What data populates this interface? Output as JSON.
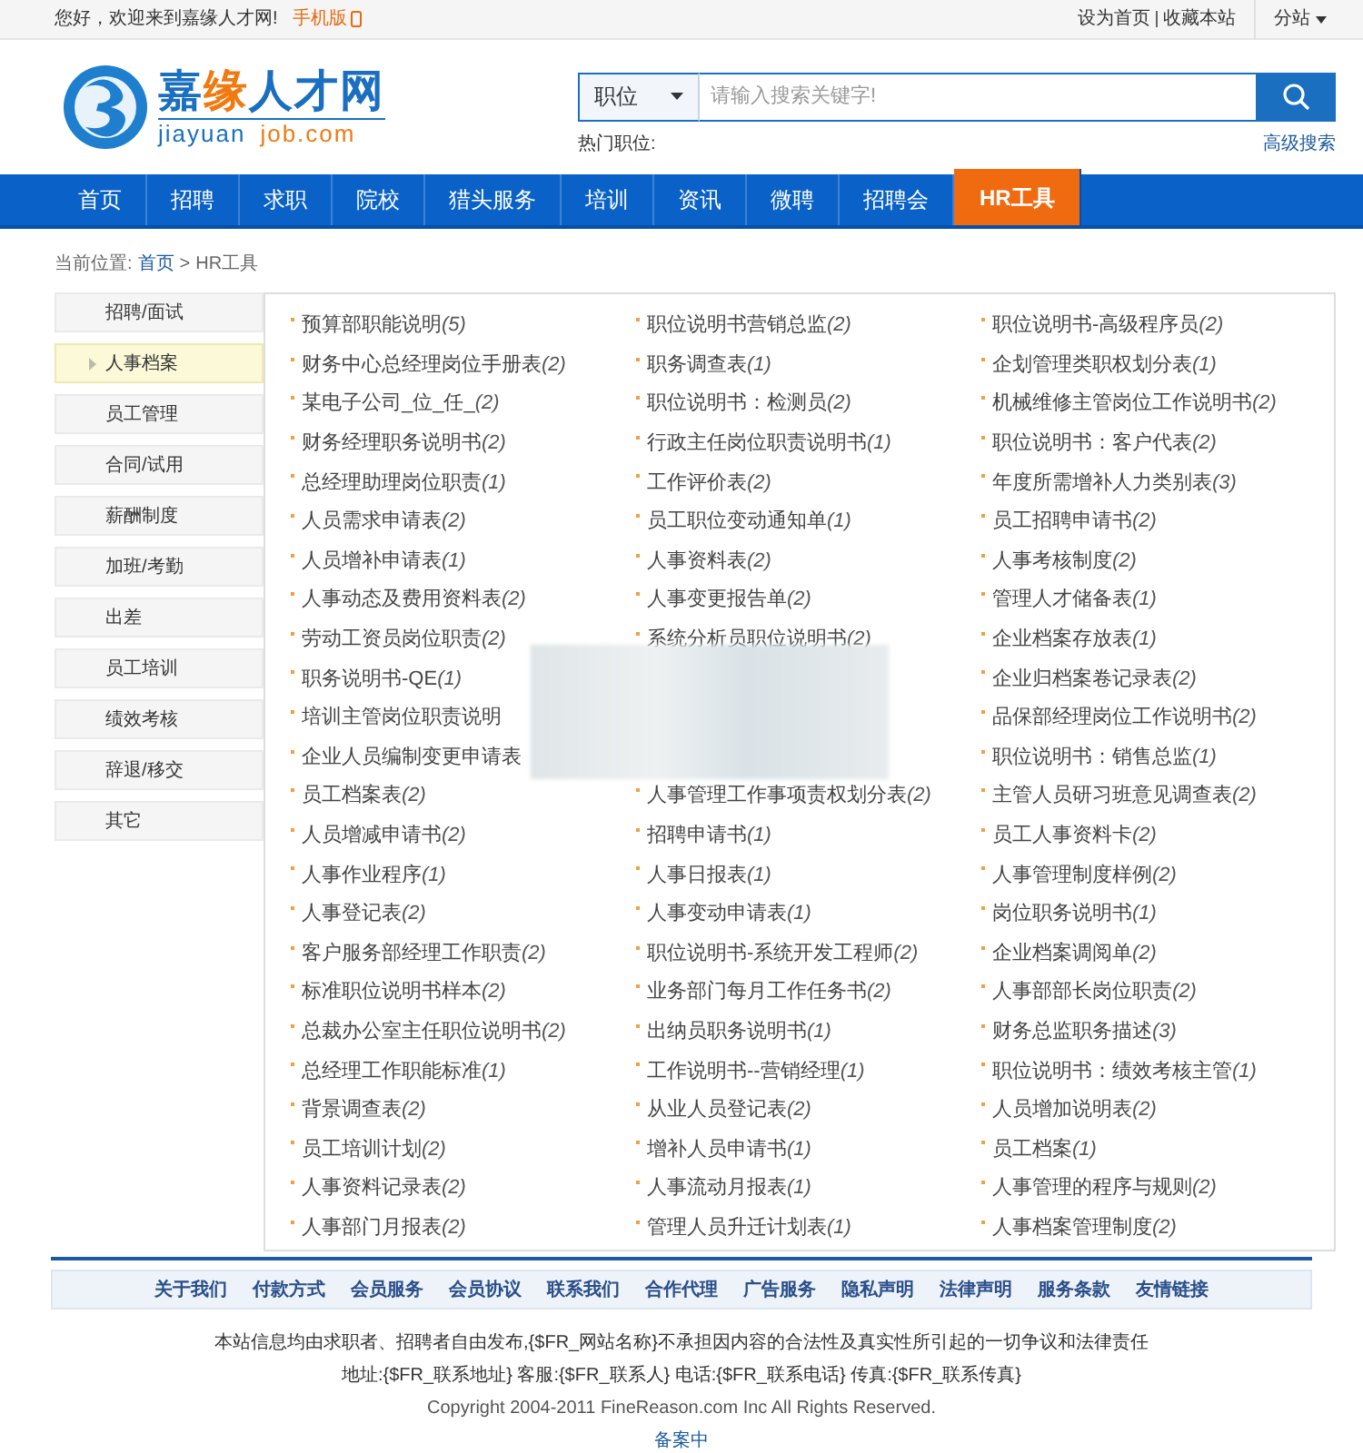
{
  "top_bar": {
    "welcome": "您好，欢迎来到嘉缘人才网!",
    "mobile": "手机版",
    "links": [
      "设为首页",
      "收藏本站"
    ],
    "substation": "分站"
  },
  "logo": {
    "title": [
      {
        "text": "嘉",
        "accent": false
      },
      {
        "text": "缘",
        "accent": true
      },
      {
        "text": "人才网",
        "accent": false
      }
    ],
    "domain": [
      {
        "text": "jiayuan",
        "accent": false
      },
      {
        "text": "job.com",
        "accent": true
      }
    ]
  },
  "search": {
    "category": "职位",
    "placeholder": "请输入搜索关键字!",
    "hot_label": "热门职位:",
    "advanced": "高级搜索"
  },
  "nav": [
    {
      "label": "首页",
      "selected": false
    },
    {
      "label": "招聘",
      "selected": false
    },
    {
      "label": "求职",
      "selected": false
    },
    {
      "label": "院校",
      "selected": false
    },
    {
      "label": "猎头服务",
      "selected": false
    },
    {
      "label": "培训",
      "selected": false
    },
    {
      "label": "资讯",
      "selected": false
    },
    {
      "label": "微聘",
      "selected": false
    },
    {
      "label": "招聘会",
      "selected": false
    },
    {
      "label": "HR工具",
      "selected": true
    }
  ],
  "breadcrumb": {
    "label": "当前位置:",
    "home": "首页",
    "separator": ">",
    "current": "HR工具"
  },
  "sidebar": [
    {
      "label": "招聘/面试",
      "selected": false
    },
    {
      "label": "人事档案",
      "selected": true
    },
    {
      "label": "员工管理",
      "selected": false
    },
    {
      "label": "合同/试用",
      "selected": false
    },
    {
      "label": "薪酬制度",
      "selected": false
    },
    {
      "label": "加班/考勤",
      "selected": false
    },
    {
      "label": "出差",
      "selected": false
    },
    {
      "label": "员工培训",
      "selected": false
    },
    {
      "label": "绩效考核",
      "selected": false
    },
    {
      "label": "辞退/移交",
      "selected": false
    },
    {
      "label": "其它",
      "selected": false
    }
  ],
  "documents": [
    [
      {
        "kind": "link",
        "title": "预算部职能说明",
        "count": "(5)"
      },
      {
        "kind": "link",
        "title": "财务中心总经理岗位手册表",
        "count": "(2)"
      },
      {
        "kind": "link",
        "title": "某电子公司_位_任_",
        "count": "(2)"
      },
      {
        "kind": "link",
        "title": "财务经理职务说明书",
        "count": "(2)"
      },
      {
        "kind": "link",
        "title": "总经理助理岗位职责",
        "count": "(1)"
      },
      {
        "kind": "link",
        "title": "人员需求申请表",
        "count": "(2)"
      },
      {
        "kind": "link",
        "title": "人员增补申请表",
        "count": "(1)"
      },
      {
        "kind": "link",
        "title": "人事动态及费用资料表",
        "count": "(2)"
      },
      {
        "kind": "link",
        "title": "劳动工资员岗位职责",
        "count": "(2)"
      },
      {
        "kind": "link",
        "title": "职务说明书-QE",
        "count": "(1)"
      },
      {
        "kind": "link",
        "title": "培训主管岗位职责说明"
      },
      {
        "kind": "link",
        "title": "企业人员编制变更申请表"
      },
      {
        "kind": "link",
        "title": "员工档案表",
        "count": "(2)"
      },
      {
        "kind": "link",
        "title": "人员增减申请书",
        "count": "(2)"
      },
      {
        "kind": "link",
        "title": "人事作业程序",
        "count": "(1)"
      },
      {
        "kind": "link",
        "title": "人事登记表",
        "count": "(2)"
      },
      {
        "kind": "link",
        "title": "客户服务部经理工作职责",
        "count": "(2)"
      },
      {
        "kind": "link",
        "title": "标准职位说明书样本",
        "count": "(2)"
      },
      {
        "kind": "link",
        "title": "总裁办公室主任职位说明书",
        "count": "(2)"
      },
      {
        "kind": "link",
        "title": "总经理工作职能标准",
        "count": "(1)"
      },
      {
        "kind": "link",
        "title": "背景调查表",
        "count": "(2)"
      },
      {
        "kind": "link",
        "title": "员工培训计划",
        "count": "(2)"
      },
      {
        "kind": "link",
        "title": "人事资料记录表",
        "count": "(2)"
      },
      {
        "kind": "link",
        "title": "人事部门月报表",
        "count": "(2)"
      }
    ],
    [
      {
        "kind": "link",
        "title": "职位说明书营销总监",
        "count": "(2)"
      },
      {
        "kind": "link",
        "title": "职务调查表",
        "count": "(1)"
      },
      {
        "kind": "link",
        "title": "职位说明书：检测员",
        "count": "(2)"
      },
      {
        "kind": "link",
        "title": "行政主任岗位职责说明书",
        "count": "(1)"
      },
      {
        "kind": "link",
        "title": "工作评价表",
        "count": "(2)"
      },
      {
        "kind": "link",
        "title": "员工职位变动通知单",
        "count": "(1)"
      },
      {
        "kind": "link",
        "title": "人事资料表",
        "count": "(2)"
      },
      {
        "kind": "link",
        "title": "人事变更报告单",
        "count": "(2)"
      },
      {
        "kind": "link",
        "title": "系统分析员职位说明书",
        "count": "(2)"
      },
      {
        "kind": "blurred"
      },
      {
        "kind": "link",
        "title": "人事管理工作事项责权划分表",
        "count": "(2)"
      },
      {
        "kind": "link",
        "title": "招聘申请书",
        "count": "(1)"
      },
      {
        "kind": "link",
        "title": "人事日报表",
        "count": "(1)"
      },
      {
        "kind": "link",
        "title": "人事变动申请表",
        "count": "(1)"
      },
      {
        "kind": "link",
        "title": "职位说明书-系统开发工程师",
        "count": "(2)"
      },
      {
        "kind": "link",
        "title": "业务部门每月工作任务书",
        "count": "(2)"
      },
      {
        "kind": "link",
        "title": "出纳员职务说明书",
        "count": "(1)"
      },
      {
        "kind": "link",
        "title": "工作说明书--营销经理",
        "count": "(1)"
      },
      {
        "kind": "link",
        "title": "从业人员登记表",
        "count": "(2)"
      },
      {
        "kind": "link",
        "title": "增补人员申请书",
        "count": "(1)"
      },
      {
        "kind": "link",
        "title": "人事流动月报表",
        "count": "(1)"
      },
      {
        "kind": "link",
        "title": "管理人员升迁计划表",
        "count": "(1)"
      }
    ],
    [
      {
        "kind": "link",
        "title": "职位说明书-高级程序员",
        "count": "(2)"
      },
      {
        "kind": "link",
        "title": "企划管理类职权划分表",
        "count": "(1)"
      },
      {
        "kind": "link",
        "title": "机械维修主管岗位工作说明书",
        "count": "(2)"
      },
      {
        "kind": "link",
        "title": "职位说明书：客户代表",
        "count": "(2)"
      },
      {
        "kind": "link",
        "title": "年度所需增补人力类别表",
        "count": "(3)"
      },
      {
        "kind": "link",
        "title": "员工招聘申请书",
        "count": "(2)"
      },
      {
        "kind": "link",
        "title": "人事考核制度",
        "count": "(2)"
      },
      {
        "kind": "link",
        "title": "管理人才储备表",
        "count": "(1)"
      },
      {
        "kind": "link",
        "title": "企业档案存放表",
        "count": "(1)"
      },
      {
        "kind": "link",
        "title": "企业归档案卷记录表",
        "count": "(2)"
      },
      {
        "kind": "link",
        "title": "品保部经理岗位工作说明书",
        "count": "(2)"
      },
      {
        "kind": "link",
        "title": "职位说明书：销售总监",
        "count": "(1)"
      },
      {
        "kind": "link",
        "title": "主管人员研习班意见调查表",
        "count": "(2)"
      },
      {
        "kind": "link",
        "title": "员工人事资料卡",
        "count": "(2)"
      },
      {
        "kind": "link",
        "title": "人事管理制度样例",
        "count": "(2)"
      },
      {
        "kind": "link",
        "title": "岗位职务说明书",
        "count": "(1)"
      },
      {
        "kind": "link",
        "title": "企业档案调阅单",
        "count": "(2)"
      },
      {
        "kind": "link",
        "title": "人事部部长岗位职责",
        "count": "(2)"
      },
      {
        "kind": "link",
        "title": "财务总监职务描述",
        "count": "(3)"
      },
      {
        "kind": "link",
        "title": "职位说明书：绩效考核主管",
        "count": "(1)"
      },
      {
        "kind": "link",
        "title": "人员增加说明表",
        "count": "(2)"
      },
      {
        "kind": "link",
        "title": "员工档案",
        "count": "(1)"
      },
      {
        "kind": "link",
        "title": "人事管理的程序与规则",
        "count": "(2)"
      },
      {
        "kind": "link",
        "title": "人事档案管理制度",
        "count": "(2)"
      }
    ]
  ],
  "footer": {
    "links": [
      "关于我们",
      "付款方式",
      "会员服务",
      "会员协议",
      "联系我们",
      "合作代理",
      "广告服务",
      "隐私声明",
      "法律声明",
      "服务条款",
      "友情链接"
    ],
    "disclaimer": "本站信息均由求职者、招聘者自由发布,{$FR_网站名称}不承担因内容的合法性及真实性所引起的一切争议和法律责任",
    "contact": "地址:{$FR_联系地址} 客服:{$FR_联系人} 电话:{$FR_联系电话} 传真:{$FR_联系传真}",
    "copyright": "Copyright 2004-2011 FineReason.com Inc All Rights Reserved.",
    "icp": "备案中"
  }
}
